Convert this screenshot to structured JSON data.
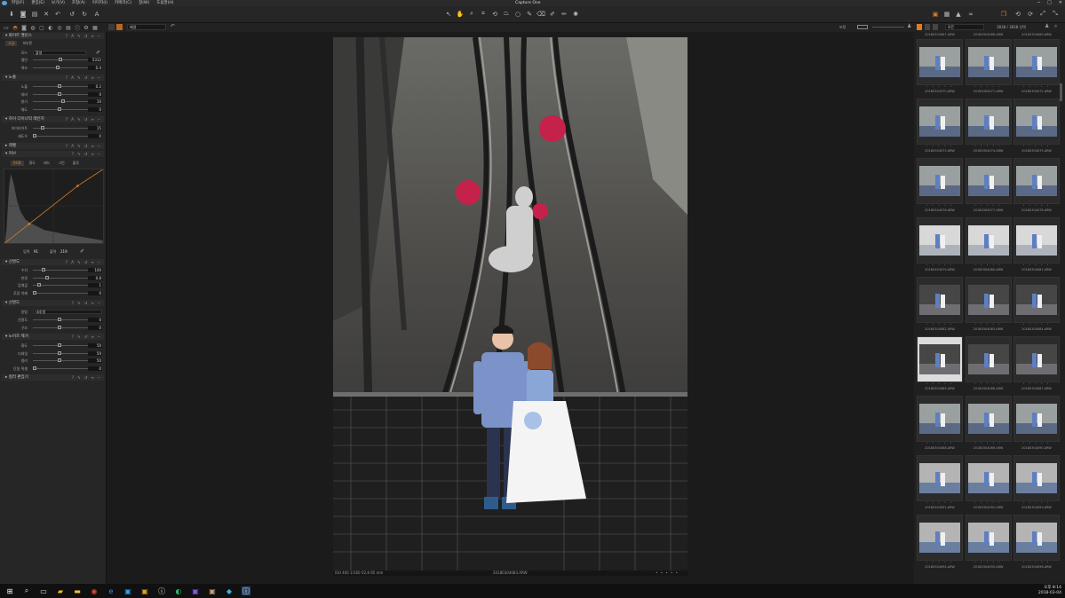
{
  "app": {
    "title": "Capture One"
  },
  "menu": [
    "파일(F)",
    "편집(E)",
    "보기(V)",
    "조정(A)",
    "이미지(I)",
    "카메라(C)",
    "창(W)",
    "도움말(H)"
  ],
  "window_buttons": [
    "─",
    "□",
    "✕"
  ],
  "subbar": {
    "preset": "배경",
    "left_label": "보정",
    "right_label": "모든",
    "count": "3838 / 3838 선택"
  },
  "left_panel": {
    "white_balance": {
      "header": "화이트 밸런스",
      "tabs": [
        "고급",
        "피부톤"
      ],
      "mode": {
        "label": "모드",
        "value": "촬영"
      },
      "sliders": [
        {
          "label": "켈빈",
          "value": "5312",
          "pos": 0.5
        },
        {
          "label": "색조",
          "value": "0.4",
          "pos": 0.44
        }
      ]
    },
    "exposure": {
      "header": "노출",
      "sliders": [
        {
          "label": "노출",
          "value": "0.2",
          "pos": 0.48
        },
        {
          "label": "대비",
          "value": "0",
          "pos": 0.48
        },
        {
          "label": "밝기",
          "value": "10",
          "pos": 0.56
        },
        {
          "label": "채도",
          "value": "0",
          "pos": 0.48
        }
      ]
    },
    "hdr": {
      "header": "하이 다이나믹 레인지",
      "sliders": [
        {
          "label": "하이라이트",
          "value": "15",
          "pos": 0.15
        },
        {
          "label": "섀도우",
          "value": "0",
          "pos": 0.0
        }
      ]
    },
    "levels": {
      "header": "레벨"
    },
    "curve": {
      "header": "커브",
      "tabs": [
        "RGB",
        "휘도",
        "레드",
        "그린",
        "블루"
      ],
      "input": {
        "label": "입력",
        "value": "91"
      },
      "output": {
        "label": "출력",
        "value": "219"
      }
    },
    "clarity": {
      "header": "선명도",
      "sliders": [
        {
          "label": "수치",
          "value": "100",
          "pos": 0.18
        },
        {
          "label": "반경",
          "value": "0.8",
          "pos": 0.24
        },
        {
          "label": "임계값",
          "value": "1",
          "pos": 0.08
        },
        {
          "label": "후광 억제",
          "value": "0",
          "pos": 0.0
        }
      ]
    },
    "sharpness": {
      "header": "선명도",
      "mode": {
        "label": "방법",
        "value": "내추럴"
      },
      "sliders": [
        {
          "label": "선명도",
          "value": "0",
          "pos": 0.48
        },
        {
          "label": "구조",
          "value": "0",
          "pos": 0.48
        }
      ]
    },
    "noise": {
      "header": "노이즈 제거",
      "sliders": [
        {
          "label": "휘도",
          "value": "50",
          "pos": 0.48
        },
        {
          "label": "디테일",
          "value": "50",
          "pos": 0.48
        },
        {
          "label": "컬러",
          "value": "50",
          "pos": 0.48
        },
        {
          "label": "단일 픽셀",
          "value": "0",
          "pos": 0.0
        }
      ]
    },
    "color_editor": {
      "header": "컬러 편집기"
    }
  },
  "viewer": {
    "info_left": "ISO 400  1/160  f/2.8  85 mm",
    "filename": "20180304083.ARW",
    "info_right": "• • • • •"
  },
  "browser": {
    "top_names": [
      "20180304067.ARW",
      "20180304068.ARW",
      "20180304069.ARW"
    ],
    "rows": [
      {
        "names": [
          "20180304070.ARW",
          "20180304071.ARW",
          "20180304072.ARW"
        ],
        "tone": "blue"
      },
      {
        "names": [
          "20180304073.ARW",
          "20180304074.ARW",
          "20180304075.ARW"
        ],
        "tone": "blue"
      },
      {
        "names": [
          "20180304076.ARW",
          "20180304077.ARW",
          "20180304078.ARW"
        ],
        "tone": "blue"
      },
      {
        "names": [
          "20180304079.ARW",
          "20180304080.ARW",
          "20180304081.ARW"
        ],
        "tone": "white"
      },
      {
        "names": [
          "20180304082.ARW",
          "20180304083.ARW",
          "20180304084.ARW"
        ],
        "tone": "dark"
      },
      {
        "names": [
          "20180304085.ARW",
          "20180304086.ARW",
          "20180304087.ARW"
        ],
        "tone": "dark"
      },
      {
        "names": [
          "20180304088.ARW",
          "20180304089.ARW",
          "20180304090.ARW"
        ],
        "tone": "blue"
      },
      {
        "names": [
          "20180304091.ARW",
          "20180304092.ARW",
          "20180304093.ARW"
        ],
        "tone": "bright"
      },
      {
        "names": [
          "20180304094.ARW",
          "20180304095.ARW",
          "20180304096.ARW"
        ],
        "tone": "bright"
      }
    ],
    "stars": "• • • • •"
  },
  "taskbar": {
    "time": "오후 8:14",
    "date": "2018-03-04"
  },
  "colors": {
    "accent": "#e07b22",
    "panel": "#262626",
    "viewer": "#1b1b1b"
  }
}
